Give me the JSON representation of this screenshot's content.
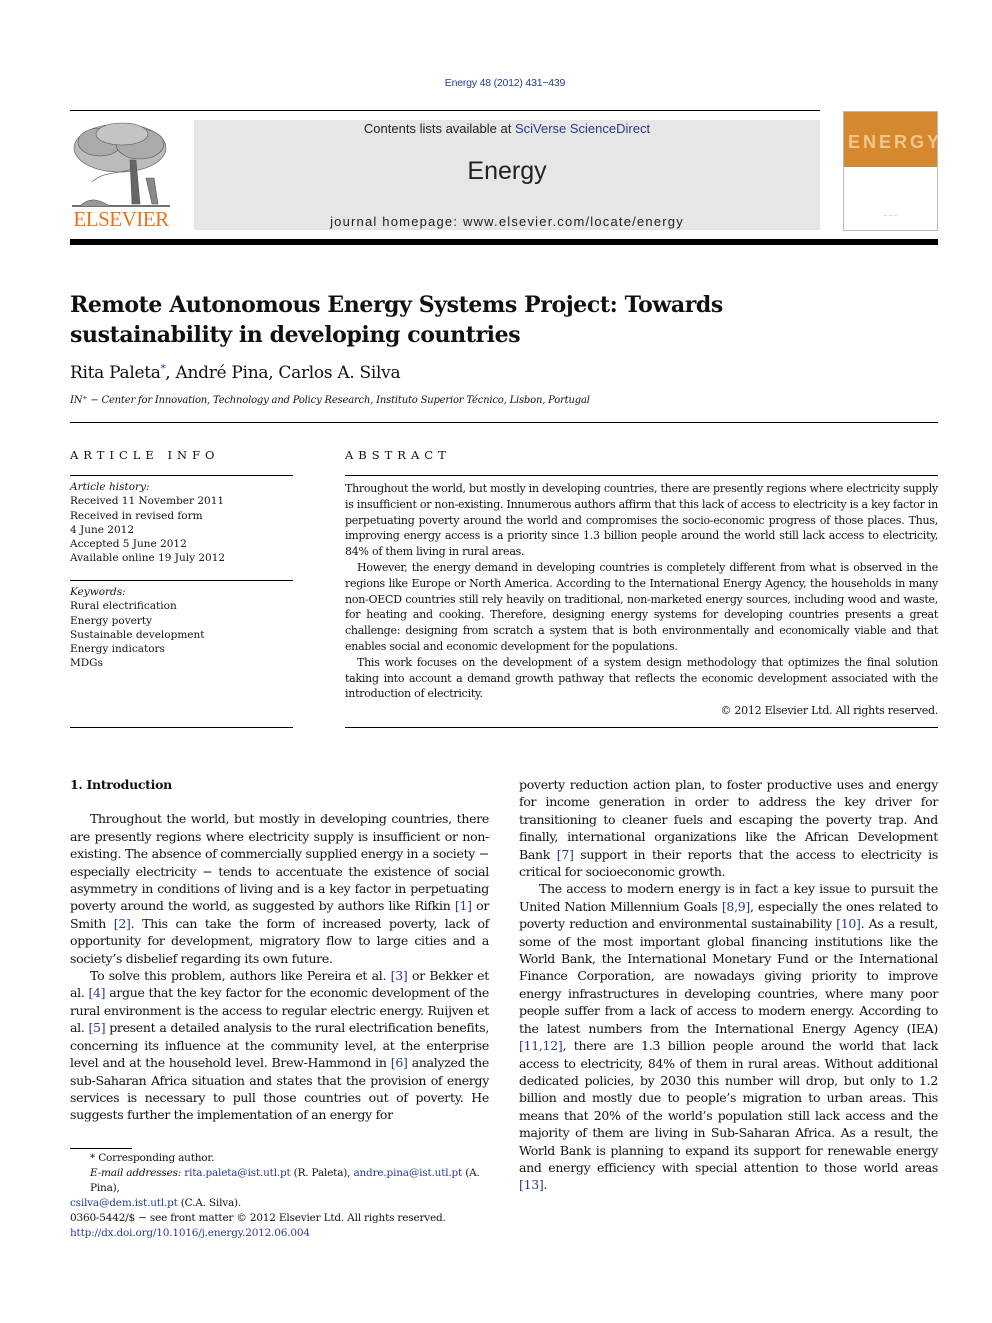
{
  "journal_ref": "Energy 48 (2012) 431−439",
  "masthead": {
    "contents_prefix": "Contents lists available at ",
    "contents_link": "SciVerse ScienceDirect",
    "journal_name": "Energy",
    "homepage": "journal homepage: www.elsevier.com/locate/energy"
  },
  "publisher_logo": {
    "icon": "elsevier-tree-icon",
    "word": "ELSEVIER",
    "color": "#e8731e"
  },
  "cover": {
    "title": "ENERGY",
    "color": "#d5882e"
  },
  "article": {
    "title": "Remote Autonomous Energy Systems Project: Towards sustainability in developing countries",
    "authors": [
      {
        "name": "Rita Paleta",
        "mark": "*"
      },
      {
        "name": "André Pina"
      },
      {
        "name": "Carlos A. Silva"
      }
    ],
    "affiliation": "IN⁺ − Center for Innovation, Technology and Policy Research, Instituto Superior Técnico, Lisbon, Portugal"
  },
  "article_info": {
    "heading": "ARTICLE INFO",
    "history_label": "Article history:",
    "history": [
      "Received 11 November 2011",
      "Received in revised form",
      "4 June 2012",
      "Accepted 5 June 2012",
      "Available online 19 July 2012"
    ],
    "keywords_label": "Keywords:",
    "keywords": [
      "Rural electrification",
      "Energy poverty",
      "Sustainable development",
      "Energy indicators",
      "MDGs"
    ]
  },
  "abstract": {
    "heading": "ABSTRACT",
    "paragraphs": [
      "Throughout the world, but mostly in developing countries, there are presently regions where electricity supply is insufficient or non-existing. Innumerous authors affirm that this lack of access to electricity is a key factor in perpetuating poverty around the world and compromises the socio-economic progress of those places. Thus, improving energy access is a priority since 1.3 billion people around the world still lack access to electricity, 84% of them living in rural areas.",
      "However, the energy demand in developing countries is completely different from what is observed in the regions like Europe or North America. According to the International Energy Agency, the households in many non-OECD countries still rely heavily on traditional, non-marketed energy sources, including wood and waste, for heating and cooking. Therefore, designing energy systems for developing countries presents a great challenge: designing from scratch a system that is both environmentally and economically viable and that enables social and economic development for the populations.",
      "This work focuses on the development of a system design methodology that optimizes the final solution taking into account a demand growth pathway that reflects the economic development associated with the introduction of electricity."
    ],
    "copyright": "© 2012 Elsevier Ltd. All rights reserved."
  },
  "body": {
    "section_heading": "1.  Introduction",
    "left": {
      "p1": [
        "Throughout the world, but mostly in developing countries, there are presently regions where electricity supply is insufficient or non-existing. The absence of commercially supplied energy in a society − especially electricity − tends to accentuate the existence of social asymmetry in conditions of living and is a key factor in perpetuating poverty around the world, as suggested by authors like Rifkin ",
        "[1]",
        " or Smith ",
        "[2]",
        ". This can take the form of increased poverty, lack of opportunity for development, migratory flow to large cities and a society’s disbelief regarding its own future."
      ],
      "p2": [
        "To solve this problem, authors like Pereira et al. ",
        "[3]",
        " or Bekker et al. ",
        "[4]",
        " argue that the key factor for the economic development of the rural environment is the access to regular electric energy. Ruijven et al. ",
        "[5]",
        " present a detailed analysis to the rural electrification benefits, concerning its influence at the community level, at the enterprise level and at the household level. Brew-Hammond in ",
        "[6]",
        " analyzed the sub-Saharan Africa situation and states that the provision of energy services is necessary to pull those countries out of poverty. He suggests further the implementation of an energy for"
      ]
    },
    "right": {
      "p1": [
        "poverty reduction action plan, to foster productive uses and energy for income generation in order to address the key driver for transitioning to cleaner fuels and escaping the poverty trap. And finally, international organizations like the African Development Bank ",
        "[7]",
        " support in their reports that the access to electricity is critical for socioeconomic growth."
      ],
      "p2": [
        "The access to modern energy is in fact a key issue to pursuit the United Nation Millennium Goals ",
        "[8,9]",
        ", especially the ones related to poverty reduction and environmental sustainability ",
        "[10]",
        ". As a result, some of the most important global financing institutions like the World Bank, the International Monetary Fund or the International Finance Corporation, are nowadays giving priority to improve energy infrastructures in developing countries, where many poor people suffer from a lack of access to modern energy. According to the latest numbers from the International Energy Agency (IEA) ",
        "[11,12]",
        ", there are 1.3 billion people around the world that lack access to electricity, 84% of them in rural areas. Without additional dedicated policies, by 2030 this number will drop, but only to 1.2 billion and mostly due to people’s migration to urban areas. This means that 20% of the world’s population still lack access and the majority of them are living in Sub-Saharan Africa. As a result, the World Bank is planning to expand its support for renewable energy and energy efficiency with special attention to those world areas ",
        "[13]",
        "."
      ]
    }
  },
  "footnote": {
    "mark": "*",
    "corresponding": "Corresponding author.",
    "email_label": "E-mail addresses:",
    "emails": [
      {
        "address": "rita.paleta@ist.utl.pt",
        "who": " (R. Paleta), "
      },
      {
        "address": "andre.pina@ist.utl.pt",
        "who": " (A. Pina), "
      },
      {
        "address": "csilva@dem.ist.utl.pt",
        "who": " (C.A. Silva)."
      }
    ]
  },
  "footer": {
    "issn": "0360-5442/$ − see front matter © 2012 Elsevier Ltd. All rights reserved.",
    "doi": "http://dx.doi.org/10.1016/j.energy.2012.06.004"
  },
  "colors": {
    "link": "#2b3a8c",
    "elsevier_orange": "#e8731e",
    "masthead_bg": "#e6e6e6"
  }
}
